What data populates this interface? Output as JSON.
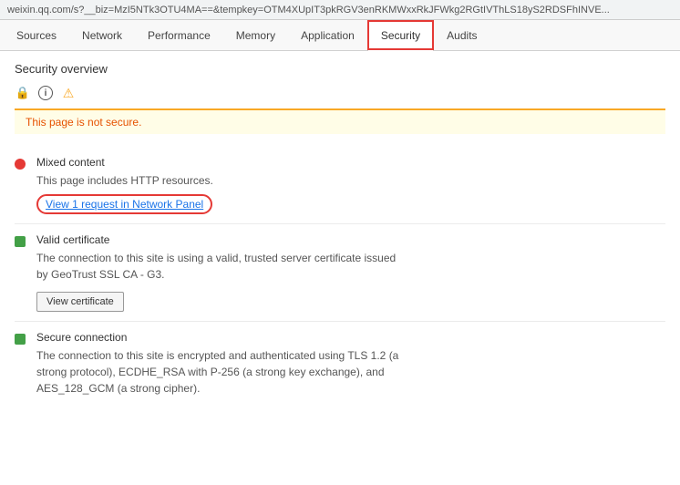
{
  "urlbar": {
    "text": "weixin.qq.com/s?__biz=MzI5NTk3OTU4MA==&tempkey=OTM4XUpIT3pkRGV3enRKMWxxRkJFWkg2RGtIVThLS18yS2RDSFhINVE..."
  },
  "tabs": [
    {
      "id": "sources",
      "label": "Sources",
      "active": false
    },
    {
      "id": "network",
      "label": "Network",
      "active": false
    },
    {
      "id": "performance",
      "label": "Performance",
      "active": false
    },
    {
      "id": "memory",
      "label": "Memory",
      "active": false
    },
    {
      "id": "application",
      "label": "Application",
      "active": false
    },
    {
      "id": "security",
      "label": "Security",
      "active": true
    },
    {
      "id": "audits",
      "label": "Audits",
      "active": false
    }
  ],
  "main": {
    "section_title": "Security overview",
    "warning_text": "This page is not secure.",
    "items": [
      {
        "id": "mixed-content",
        "status": "red",
        "title": "Mixed content",
        "description": "This page includes HTTP resources.",
        "link_text": "View 1 request in Network Panel",
        "has_link": true,
        "has_button": false
      },
      {
        "id": "valid-certificate",
        "status": "green",
        "title": "Valid certificate",
        "description": "The connection to this site is using a valid, trusted server certificate issued\nby GeoTrust SSL CA - G3.",
        "link_text": "",
        "has_link": false,
        "has_button": true,
        "button_label": "View certificate"
      },
      {
        "id": "secure-connection",
        "status": "green",
        "title": "Secure connection",
        "description": "The connection to this site is encrypted and authenticated using TLS 1.2 (a\nstrong protocol), ECDHE_RSA with P-256 (a strong key exchange), and\nAES_128_GCM (a strong cipher).",
        "link_text": "",
        "has_link": false,
        "has_button": false
      }
    ]
  },
  "icons": {
    "lock": "🔒",
    "info": "ℹ",
    "warning": "⚠"
  }
}
